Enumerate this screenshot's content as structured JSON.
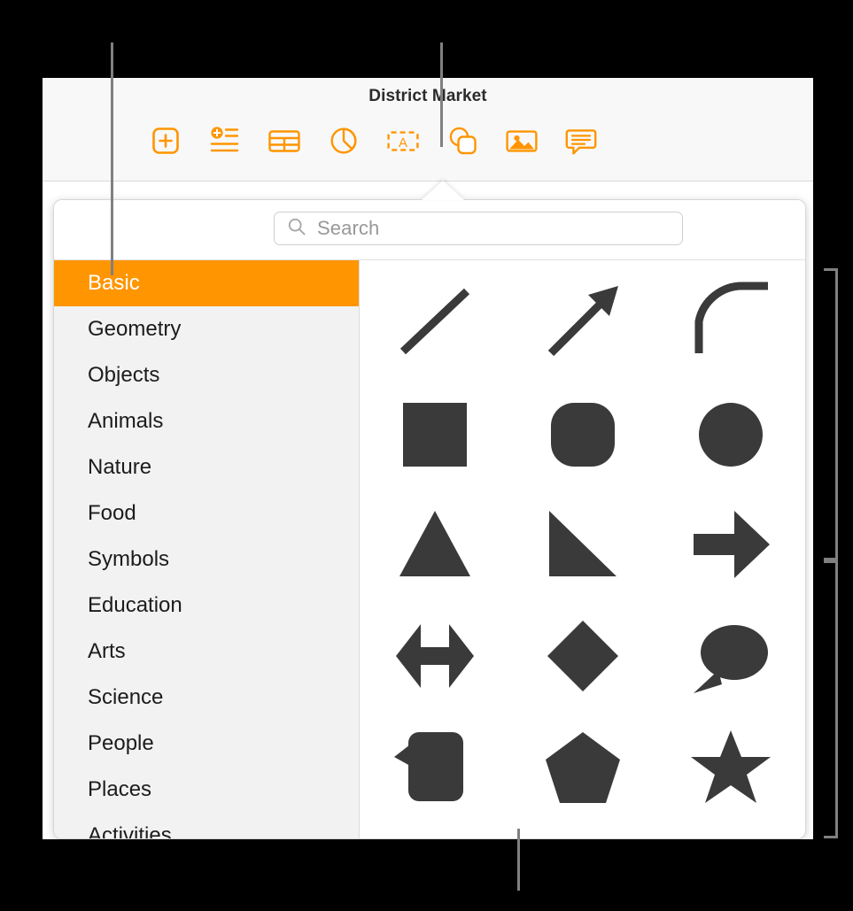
{
  "window": {
    "document_title": "District Market"
  },
  "toolbar": {
    "buttons": [
      {
        "name": "add-slide-button",
        "icon": "plus-in-square-icon"
      },
      {
        "name": "add-text-button",
        "icon": "add-list-item-icon"
      },
      {
        "name": "table-button",
        "icon": "table-icon"
      },
      {
        "name": "chart-button",
        "icon": "pie-chart-icon"
      },
      {
        "name": "text-box-button",
        "icon": "text-box-icon"
      },
      {
        "name": "shape-button",
        "icon": "shapes-icon"
      },
      {
        "name": "media-button",
        "icon": "image-icon"
      },
      {
        "name": "comment-button",
        "icon": "comment-icon"
      }
    ]
  },
  "popover": {
    "search": {
      "placeholder": "Search",
      "value": "",
      "icon": "search-icon"
    },
    "categories": [
      {
        "label": "Basic",
        "selected": true
      },
      {
        "label": "Geometry",
        "selected": false
      },
      {
        "label": "Objects",
        "selected": false
      },
      {
        "label": "Animals",
        "selected": false
      },
      {
        "label": "Nature",
        "selected": false
      },
      {
        "label": "Food",
        "selected": false
      },
      {
        "label": "Symbols",
        "selected": false
      },
      {
        "label": "Education",
        "selected": false
      },
      {
        "label": "Arts",
        "selected": false
      },
      {
        "label": "Science",
        "selected": false
      },
      {
        "label": "People",
        "selected": false
      },
      {
        "label": "Places",
        "selected": false
      },
      {
        "label": "Activities",
        "selected": false
      }
    ],
    "shapes": [
      {
        "name": "line-shape",
        "icon": "diagonal-line-icon"
      },
      {
        "name": "arrow-shape",
        "icon": "diagonal-arrow-icon"
      },
      {
        "name": "curved-line-shape",
        "icon": "quarter-arc-icon"
      },
      {
        "name": "square-shape",
        "icon": "square-icon"
      },
      {
        "name": "rounded-square-shape",
        "icon": "rounded-square-icon"
      },
      {
        "name": "circle-shape",
        "icon": "circle-icon"
      },
      {
        "name": "triangle-shape",
        "icon": "triangle-icon"
      },
      {
        "name": "right-triangle-shape",
        "icon": "right-triangle-icon"
      },
      {
        "name": "right-arrow-shape",
        "icon": "block-arrow-right-icon"
      },
      {
        "name": "double-arrow-shape",
        "icon": "block-arrow-double-icon"
      },
      {
        "name": "diamond-shape",
        "icon": "diamond-icon"
      },
      {
        "name": "speech-bubble-shape",
        "icon": "speech-bubble-icon"
      },
      {
        "name": "callout-shape",
        "icon": "quote-bubble-icon"
      },
      {
        "name": "pentagon-shape",
        "icon": "pentagon-icon"
      },
      {
        "name": "star-shape",
        "icon": "star-icon"
      }
    ]
  },
  "colors": {
    "accent_orange": "#FF9500",
    "shape_fill": "#3a3a3a",
    "sidebar_background": "#F2F2F2",
    "toolbar_background": "#F8F8F8",
    "callout_gray": "#808080"
  }
}
